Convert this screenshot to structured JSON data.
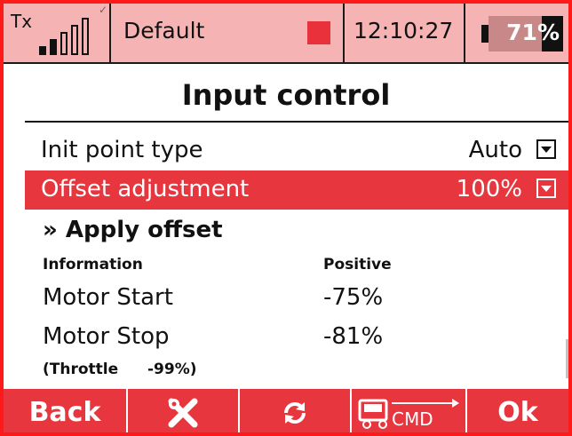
{
  "status_bar": {
    "tx_label": "Tx",
    "signal_bars_filled": 2,
    "signal_bars_total": 5,
    "model_name": "Default",
    "time": "12:10:27",
    "battery_percent_text": "71%",
    "battery_level": 0.71
  },
  "page": {
    "title": "Input control"
  },
  "rows": {
    "init_point": {
      "label": "Init point type",
      "value": "Auto"
    },
    "offset_adjustment": {
      "label": "Offset adjustment",
      "value": "100%"
    }
  },
  "apply_offset": "» Apply offset",
  "info": {
    "header_left": "Information",
    "header_right": "Positive",
    "motor_start_label": "Motor Start",
    "motor_start_value": "-75%",
    "motor_stop_label": "Motor Stop",
    "motor_stop_value": "-81%",
    "throttle_label": "(Throttle",
    "throttle_value": "-99%)"
  },
  "bottom_bar": {
    "back_label": "Back",
    "tools_icon": "wrench-screwdriver-icon",
    "refresh_icon": "refresh-icon",
    "cmd_icon": "transmitter-cmd-icon",
    "ok_label": "Ok"
  },
  "colors": {
    "frame": "#ff1a1a",
    "status_bg": "#f6b3b3",
    "accent": "#e8363f",
    "text": "#111111"
  }
}
